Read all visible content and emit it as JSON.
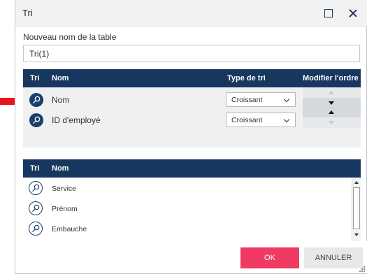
{
  "window": {
    "title": "Tri"
  },
  "table_name": {
    "label": "Nouveau nom de la table",
    "value": "Tri(1)"
  },
  "sort_table": {
    "headers": {
      "tri": "Tri",
      "nom": "Nom",
      "type": "Type de tri",
      "order": "Modifier l'ordre"
    },
    "rows": [
      {
        "label": "Nom",
        "sort_type": "Croissant",
        "icon": "key-icon"
      },
      {
        "label": "ID d'employé",
        "sort_type": "Croissant",
        "icon": "key-icon"
      }
    ]
  },
  "fields_table": {
    "headers": {
      "tri": "Tri",
      "nom": "Nom"
    },
    "items": [
      {
        "label": "Service",
        "icon": "key-outline-icon"
      },
      {
        "label": "Prénom",
        "icon": "key-outline-icon"
      },
      {
        "label": "Embauche",
        "icon": "key-outline-icon"
      }
    ]
  },
  "buttons": {
    "ok": "OK",
    "cancel": "ANNULER"
  },
  "colors": {
    "header_bg": "#17375e",
    "ok_bg": "#f03a63",
    "cancel_bg": "#e8e8e8",
    "annotation_arrow": "#e8161c"
  }
}
